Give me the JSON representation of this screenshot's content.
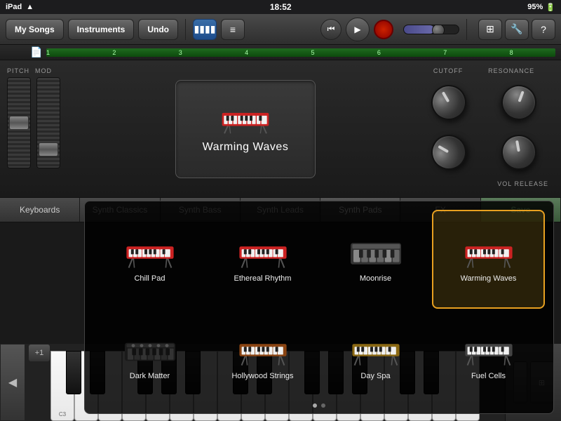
{
  "statusBar": {
    "left": "iPad",
    "wifi": "wifi",
    "time": "18:52",
    "battery": "95%"
  },
  "toolbar": {
    "mySongs": "My Songs",
    "instruments": "Instruments",
    "undo": "Undo"
  },
  "synth": {
    "instrumentName": "Warming Waves",
    "pitchLabel": "PITCH",
    "modLabel": "MOD",
    "cutoffLabel": "CUTOFF",
    "resonanceLabel": "RESONANCE",
    "volReleaseLabel": "VOL RELEASE"
  },
  "categories": {
    "tabs": [
      {
        "label": "Keyboards",
        "active": false
      },
      {
        "label": "Synth Classics",
        "active": false
      },
      {
        "label": "Synth Bass",
        "active": false
      },
      {
        "label": "Synth Leads",
        "active": false
      },
      {
        "label": "Synth Pads",
        "active": true
      },
      {
        "label": "FX",
        "active": false
      },
      {
        "label": "Save",
        "active": false,
        "isSave": true
      }
    ]
  },
  "presets": [
    {
      "name": "Chill Pad",
      "selected": false
    },
    {
      "name": "Ethereal Rhythm",
      "selected": false
    },
    {
      "name": "Moonrise",
      "selected": false
    },
    {
      "name": "Warming Waves",
      "selected": true
    },
    {
      "name": "Dark Matter",
      "selected": false
    },
    {
      "name": "Hollywood Strings",
      "selected": false
    },
    {
      "name": "Day Spa",
      "selected": false
    },
    {
      "name": "Fuel Cells",
      "selected": false
    }
  ],
  "piano": {
    "noteLabel": "C3"
  },
  "timeline": {
    "markers": [
      "1",
      "2",
      "3",
      "4",
      "5",
      "6",
      "7",
      "8"
    ]
  }
}
